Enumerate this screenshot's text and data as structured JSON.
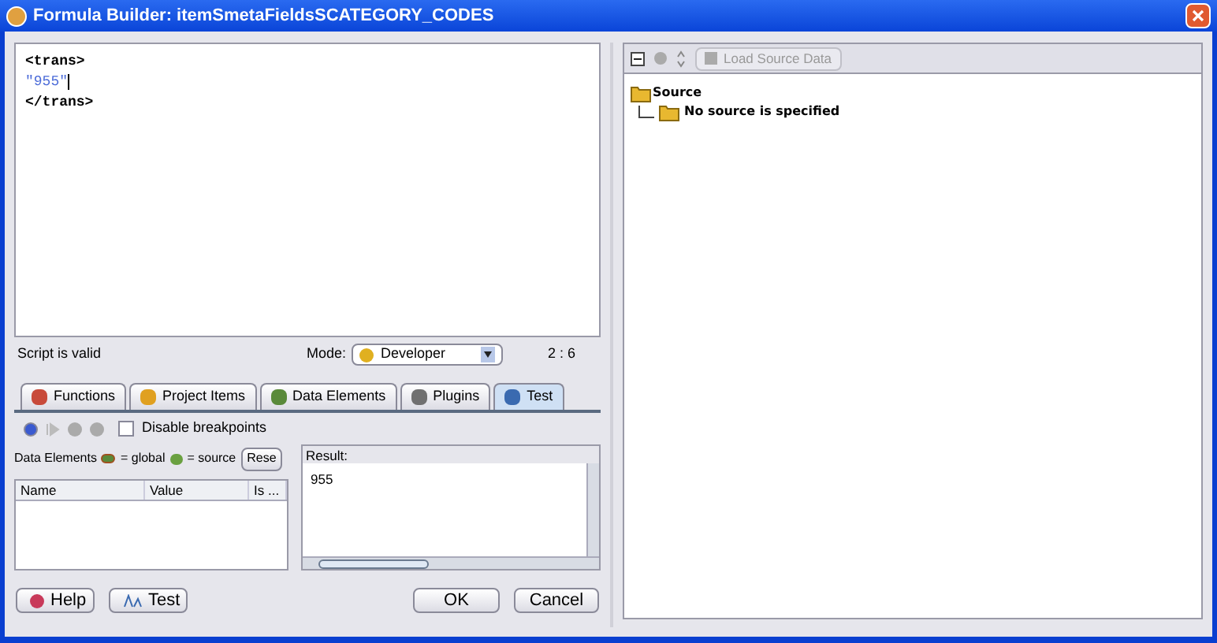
{
  "window": {
    "title": "Formula Builder: itemSmetaFieldsSCATEGORY_CODES"
  },
  "editor": {
    "lines": [
      {
        "text": "<trans>",
        "kind": "tag"
      },
      {
        "text": "\"955\"",
        "kind": "string",
        "cursor": true
      },
      {
        "text": "</trans>",
        "kind": "tag"
      }
    ]
  },
  "status": {
    "message": "Script is valid",
    "mode_label": "Mode:",
    "mode_value": "Developer",
    "position": "2 : 6"
  },
  "tabs": [
    {
      "label": "Functions",
      "selected": false
    },
    {
      "label": "Project Items",
      "selected": false
    },
    {
      "label": "Data Elements",
      "selected": false
    },
    {
      "label": "Plugins",
      "selected": false
    },
    {
      "label": "Test",
      "selected": true
    }
  ],
  "test_toolbar": {
    "checkbox": {
      "label": "Disable breakpoints",
      "checked": false
    }
  },
  "data_elements": {
    "label": "Data Elements",
    "legend": [
      "= global",
      "= source"
    ],
    "reset_button": "Rese",
    "columns": [
      "Name",
      "Value",
      "Is ..."
    ]
  },
  "result": {
    "label": "Result:",
    "value": "955"
  },
  "buttons": [
    {
      "label": "Help",
      "kind": "help"
    },
    {
      "label": "Test",
      "kind": "test"
    },
    {
      "label": "OK",
      "kind": "ok"
    },
    {
      "label": "Cancel",
      "kind": "cancel"
    }
  ],
  "source_toolbar": {
    "load_button": "Load Source Data"
  },
  "tree": {
    "label": "Source",
    "children": [
      {
        "label": "No source is specified"
      }
    ]
  }
}
